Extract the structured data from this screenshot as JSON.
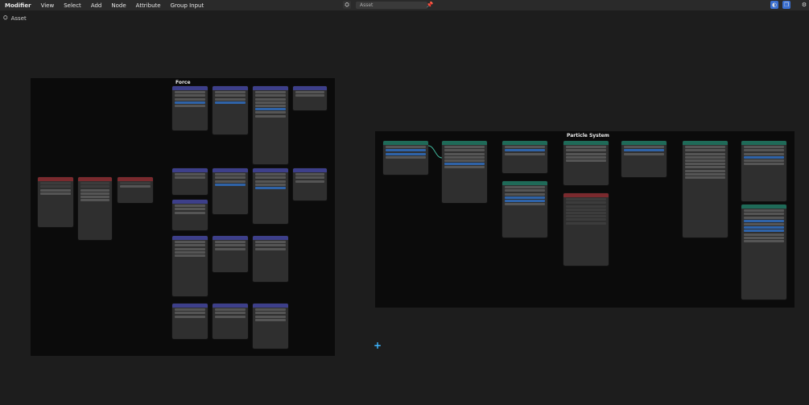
{
  "menu": {
    "editor_label": "Modifier",
    "items": [
      "View",
      "Select",
      "Add",
      "Node",
      "Attribute",
      "Group Input"
    ]
  },
  "asset_field": "Asset",
  "header_label": "Asset",
  "frames": {
    "force_label": "Force",
    "particle_label": "Particle System"
  },
  "colors": {
    "geometry_header": "#3d3f8a",
    "mesh_header": "#7a2a2e",
    "particle_header": "#1f6a58",
    "frame": "#0b0b0b"
  }
}
